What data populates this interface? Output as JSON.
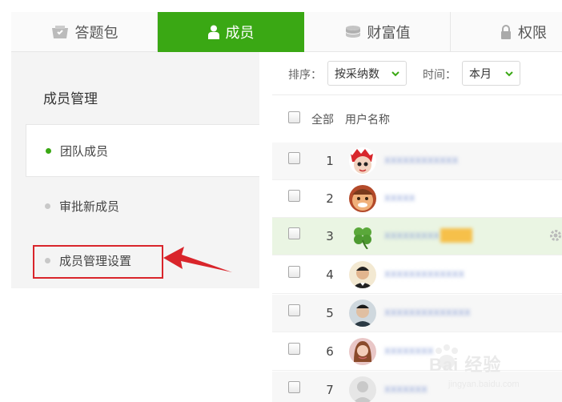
{
  "tabs": [
    {
      "label": "答题包",
      "icon": "question-pack-icon",
      "active": false
    },
    {
      "label": "成员",
      "icon": "member-icon",
      "active": true
    },
    {
      "label": "财富值",
      "icon": "coins-icon",
      "active": false
    },
    {
      "label": "权限",
      "icon": "lock-icon",
      "active": false
    }
  ],
  "sidebar": {
    "title": "成员管理",
    "items": [
      {
        "label": "团队成员",
        "active": true
      },
      {
        "label": "审批新成员",
        "active": false
      },
      {
        "label": "成员管理设置",
        "active": false
      }
    ]
  },
  "toolbar": {
    "sort_label": "排序：",
    "sort_value": "按采纳数",
    "time_label": "时间：",
    "time_value": "本月"
  },
  "list_header": {
    "select_all": "全部",
    "username_col": "用户名称"
  },
  "members": [
    {
      "index": "1",
      "name": "xxxxxxxxxxxx",
      "avatar": "avatar-red-cartoon"
    },
    {
      "index": "2",
      "name": "xxxxx",
      "avatar": "avatar-cartoon-face"
    },
    {
      "index": "3",
      "name": "xxxxxxxxx",
      "avatar": "avatar-clover"
    },
    {
      "index": "4",
      "name": "xxxxxxxxxxxxx",
      "avatar": "avatar-man-photo"
    },
    {
      "index": "5",
      "name": "xxxxxxxxxxxxxx",
      "avatar": "avatar-man-photo"
    },
    {
      "index": "6",
      "name": "xxxxxxxx",
      "avatar": "avatar-woman-photo"
    },
    {
      "index": "7",
      "name": "xxxxxxx",
      "avatar": "avatar-default"
    }
  ],
  "watermark": {
    "text": "Bai 经验",
    "sub": "jingyan.baidu.com"
  },
  "colors": {
    "accent": "#3aa814",
    "highlight_row": "#eaf5e3",
    "annotation_red": "#d9252b"
  }
}
